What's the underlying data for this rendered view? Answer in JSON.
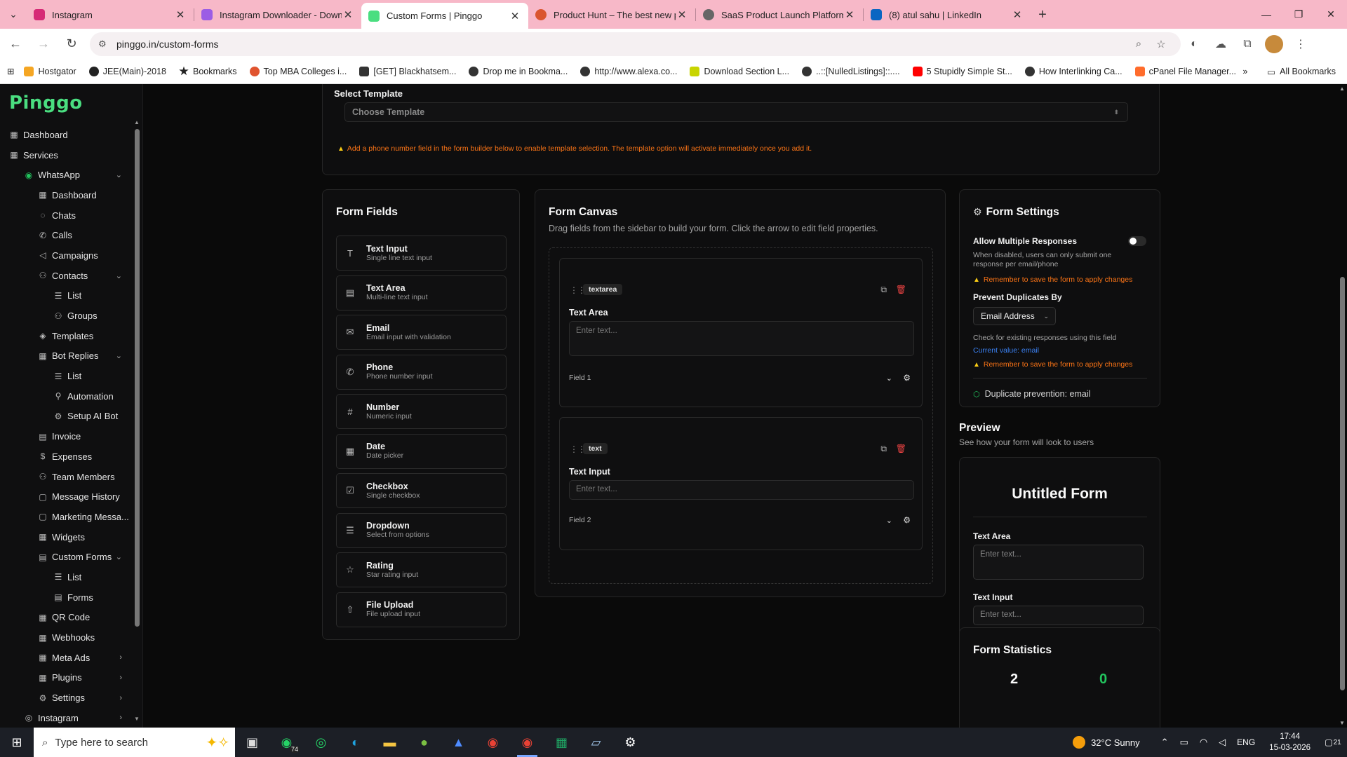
{
  "browser": {
    "tabs": [
      {
        "title": "Instagram",
        "color": "#d62976"
      },
      {
        "title": "Instagram Downloader - Downl",
        "color": "#9b5de5"
      },
      {
        "title": "Custom Forms | Pinggo",
        "color": "#4ade80"
      },
      {
        "title": "Product Hunt – The best new p",
        "color": "#da552f"
      },
      {
        "title": "SaaS Product Launch Platforms",
        "color": "#666666"
      },
      {
        "title": "(8) atul sahu | LinkedIn",
        "color": "#0a66c2"
      }
    ],
    "url": "pinggo.in/custom-forms",
    "bookmarks": [
      {
        "label": "Hostgator",
        "color": "#f5a623"
      },
      {
        "label": "JEE(Main)-2018",
        "color": "#222222"
      },
      {
        "label": "Bookmarks",
        "color": "#222222"
      },
      {
        "label": "Top MBA Colleges i...",
        "color": "#e0542f"
      },
      {
        "label": "[GET] Blackhatsem...",
        "color": "#333333"
      },
      {
        "label": "Drop me in Bookma...",
        "color": "#333333"
      },
      {
        "label": "http://www.alexa.co...",
        "color": "#333333"
      },
      {
        "label": "Download Section L...",
        "color": "#c8d400"
      },
      {
        "label": "..::[NulledListings]::....",
        "color": "#333333"
      },
      {
        "label": "5 Stupidly Simple St...",
        "color": "#ff0000"
      },
      {
        "label": "How Interlinking Ca...",
        "color": "#333333"
      },
      {
        "label": "cPanel File Manager...",
        "color": "#ff6c2c"
      }
    ],
    "all_bookmarks": "All Bookmarks"
  },
  "sidebar": {
    "logo": "Pinggo",
    "items": [
      {
        "label": "Dashboard",
        "icon": "▦",
        "level": 0
      },
      {
        "label": "Services",
        "icon": "▦",
        "level": 0
      },
      {
        "label": "WhatsApp",
        "icon": "◉",
        "level": 1,
        "chevron": "⌄"
      },
      {
        "label": "Dashboard",
        "icon": "▦",
        "level": 2
      },
      {
        "label": "Chats",
        "icon": "◌",
        "level": 2
      },
      {
        "label": "Calls",
        "icon": "✆",
        "level": 2
      },
      {
        "label": "Campaigns",
        "icon": "◁",
        "level": 2
      },
      {
        "label": "Contacts",
        "icon": "⚇",
        "level": 2,
        "chevron": "⌄"
      },
      {
        "label": "List",
        "icon": "☰",
        "level": 3
      },
      {
        "label": "Groups",
        "icon": "⚇",
        "level": 3
      },
      {
        "label": "Templates",
        "icon": "◈",
        "level": 2
      },
      {
        "label": "Bot Replies",
        "icon": "▦",
        "level": 2,
        "chevron": "⌄"
      },
      {
        "label": "List",
        "icon": "☰",
        "level": 3
      },
      {
        "label": "Automation",
        "icon": "⚲",
        "level": 3
      },
      {
        "label": "Setup AI Bot",
        "icon": "⚙",
        "level": 3
      },
      {
        "label": "Invoice",
        "icon": "▤",
        "level": 2
      },
      {
        "label": "Expenses",
        "icon": "$",
        "level": 2
      },
      {
        "label": "Team Members",
        "icon": "⚇",
        "level": 2
      },
      {
        "label": "Message History",
        "icon": "▢",
        "level": 2
      },
      {
        "label": "Marketing Messa...",
        "icon": "▢",
        "level": 2
      },
      {
        "label": "Widgets",
        "icon": "▦",
        "level": 2
      },
      {
        "label": "Custom Forms",
        "icon": "▤",
        "level": 2,
        "chevron": "⌄"
      },
      {
        "label": "List",
        "icon": "☰",
        "level": 3
      },
      {
        "label": "Forms",
        "icon": "▤",
        "level": 3
      },
      {
        "label": "QR Code",
        "icon": "▦",
        "level": 2
      },
      {
        "label": "Webhooks",
        "icon": "▦",
        "level": 2
      },
      {
        "label": "Meta Ads",
        "icon": "▦",
        "level": 2,
        "chevron": "›"
      },
      {
        "label": "Plugins",
        "icon": "▦",
        "level": 2,
        "chevron": "›"
      },
      {
        "label": "Settings",
        "icon": "⚙",
        "level": 2,
        "chevron": "›"
      },
      {
        "label": "Instagram",
        "icon": "◎",
        "level": 1,
        "chevron": "›"
      }
    ]
  },
  "template": {
    "label": "Select Template",
    "placeholder": "Choose Template",
    "warning": "Add a phone number field in the form builder below to enable template selection. The template option will activate immediately once you add it."
  },
  "form_fields": {
    "title": "Form Fields",
    "items": [
      {
        "title": "Text Input",
        "desc": "Single line text input",
        "icon": "T"
      },
      {
        "title": "Text Area",
        "desc": "Multi-line text input",
        "icon": "▤"
      },
      {
        "title": "Email",
        "desc": "Email input with validation",
        "icon": "✉"
      },
      {
        "title": "Phone",
        "desc": "Phone number input",
        "icon": "✆"
      },
      {
        "title": "Number",
        "desc": "Numeric input",
        "icon": "#"
      },
      {
        "title": "Date",
        "desc": "Date picker",
        "icon": "▦"
      },
      {
        "title": "Checkbox",
        "desc": "Single checkbox",
        "icon": "☑"
      },
      {
        "title": "Dropdown",
        "desc": "Select from options",
        "icon": "☰"
      },
      {
        "title": "Rating",
        "desc": "Star rating input",
        "icon": "☆"
      },
      {
        "title": "File Upload",
        "desc": "File upload input",
        "icon": "⇧"
      }
    ]
  },
  "canvas": {
    "title": "Form Canvas",
    "subtitle": "Drag fields from the sidebar to build your form. Click the arrow to edit field properties.",
    "fields": [
      {
        "tag": "textarea",
        "label": "Text Area",
        "placeholder": "Enter text...",
        "name": "Field 1"
      },
      {
        "tag": "text",
        "label": "Text Input",
        "placeholder": "Enter text...",
        "name": "Field 2"
      }
    ]
  },
  "settings": {
    "title": "Form Settings",
    "allow_multiple": "Allow Multiple Responses",
    "allow_multiple_help": "When disabled, users can only submit one response per email/phone",
    "warning": "Remember to save the form to apply changes",
    "prevent_label": "Prevent Duplicates By",
    "prevent_value": "Email Address",
    "check_help": "Check for existing responses using this field",
    "current_value": "Current value: email",
    "duplicate_status": "Duplicate prevention: email"
  },
  "preview": {
    "title": "Preview",
    "subtitle": "See how your form will look to users",
    "form_title": "Untitled Form",
    "fields": [
      {
        "label": "Text Area",
        "placeholder": "Enter text..."
      },
      {
        "label": "Text Input",
        "placeholder": "Enter text..."
      }
    ]
  },
  "stats": {
    "title": "Form Statistics",
    "total": "2",
    "responses": "0"
  },
  "taskbar": {
    "search": "Type here to search",
    "whatsapp_badge": "74",
    "weather": "32°C  Sunny",
    "lang": "ENG",
    "time": "17:44",
    "date": "15-03-2026",
    "notifications": "21"
  }
}
